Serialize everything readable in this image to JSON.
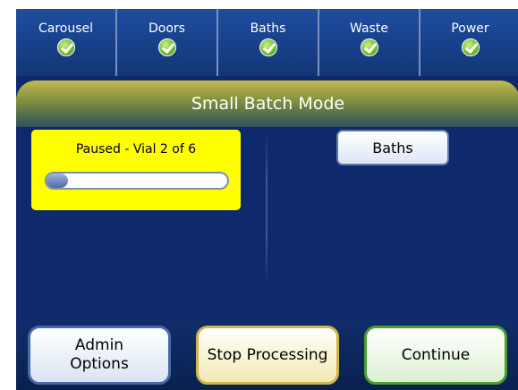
{
  "status": [
    {
      "label": "Carousel",
      "state": "ok"
    },
    {
      "label": "Doors",
      "state": "ok"
    },
    {
      "label": "Baths",
      "state": "ok"
    },
    {
      "label": "Waste",
      "state": "ok"
    },
    {
      "label": "Power",
      "state": "ok"
    }
  ],
  "title": "Small Batch Mode",
  "batch": {
    "status_text": "Paused - Vial 2 of 6",
    "progress_fraction": 0.12
  },
  "buttons": {
    "baths": "Baths",
    "admin": "Admin\nOptions",
    "stop": "Stop Processing",
    "continue": "Continue"
  },
  "colors": {
    "background": "#0e2a6d",
    "paused_card": "#ffff00",
    "ok_icon": "#5fb11c"
  }
}
